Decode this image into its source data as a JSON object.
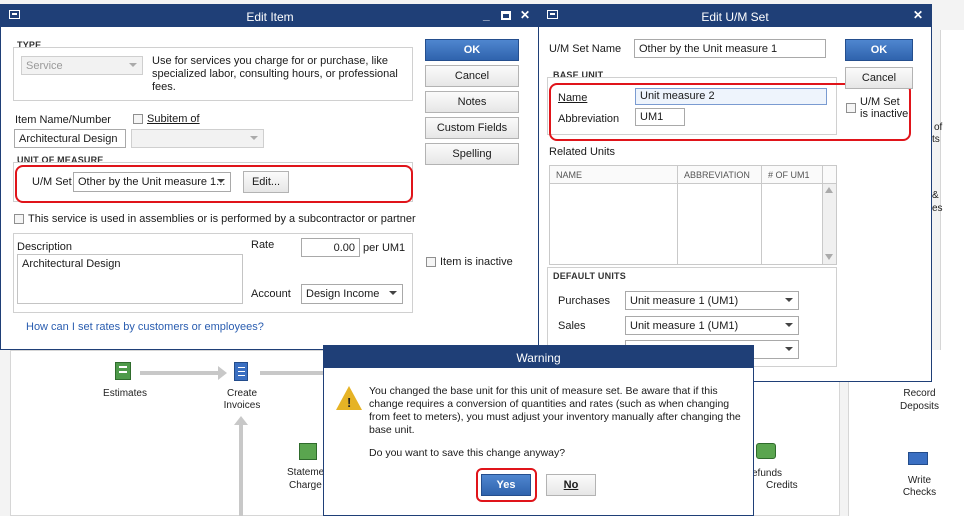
{
  "edit_item": {
    "title": "Edit Item",
    "type_section": "TYPE",
    "type_value": "Service",
    "type_description": "Use for services you charge for or purchase, like specialized labor, consulting hours, or professional fees.",
    "item_name_label": "Item Name/Number",
    "item_name_value": "Architectural Design",
    "subitem_label": "Subitem of",
    "uom_section": "UNIT OF MEASURE",
    "um_set_label": "U/M Set",
    "um_set_value": "Other by the Unit measure 1...",
    "edit_button": "Edit...",
    "assembly_checkbox_label": "This service is used in assemblies or is performed by a subcontractor or partner",
    "description_label": "Description",
    "description_value": "Architectural Design",
    "rate_label": "Rate",
    "rate_value": "0.00",
    "per_unit": "per UM1",
    "account_label": "Account",
    "account_value": "Design Income",
    "help_link": "How can I set rates by customers or employees?",
    "ok": "OK",
    "cancel": "Cancel",
    "notes": "Notes",
    "custom_fields": "Custom Fields",
    "spelling": "Spelling",
    "item_inactive_label": "Item is inactive"
  },
  "edit_um": {
    "title": "Edit U/M Set",
    "um_set_name_label": "U/M Set Name",
    "um_set_name_value": "Other by the Unit measure 1",
    "base_unit_section": "BASE UNIT",
    "name_label": "Name",
    "name_value": "Unit measure 2",
    "abbr_label": "Abbreviation",
    "abbr_value": "UM1",
    "inactive_label": "U/M Set is inactive",
    "ok": "OK",
    "cancel": "Cancel",
    "related_units_label": "Related Units",
    "columns": [
      "NAME",
      "ABBREVIATION",
      "# OF UM1"
    ],
    "default_units_section": "DEFAULT UNITS",
    "purchases_label": "Purchases",
    "purchases_value": "Unit measure 1 (UM1)",
    "sales_label": "Sales",
    "sales_value": "Unit measure 1 (UM1)"
  },
  "warning": {
    "title": "Warning",
    "message": "You changed the base unit for this unit of measure set. Be aware that if this change requires a conversion of quantities and rates (such as when changing from feet to meters), you must adjust your inventory manually after changing the base unit.",
    "question": "Do you want to save this change anyway?",
    "yes": "Yes",
    "no": "No"
  },
  "background": {
    "estimates": "Estimates",
    "create_invoices": "Create Invoices",
    "statements_charges_1": "Stateme",
    "statements_charges_2": "Charge",
    "refunds_credits_1": "efunds",
    "refunds_credits_2": "Credits",
    "record_deposits_1": "Record",
    "record_deposits_2": "Deposits",
    "write_checks_1": "Write",
    "write_checks_2": "Checks",
    "partial_right_1": "of",
    "partial_right_2": "ts",
    "partial_right_3": "&",
    "partial_right_4": "es"
  },
  "colors": {
    "titlebar": "#1f3f77",
    "highlight": "#e0141a",
    "primary_button": "#2f63ad"
  }
}
